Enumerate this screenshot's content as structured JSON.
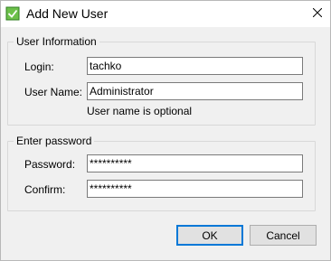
{
  "window": {
    "title": "Add New User",
    "icon": "app-icon",
    "close_icon": "close-icon"
  },
  "user_info": {
    "legend": "User Information",
    "login_label": "Login:",
    "login_value": "tachko",
    "username_label": "User Name:",
    "username_value": "Administrator",
    "hint": "User name is optional"
  },
  "password": {
    "legend": "Enter password",
    "password_label": "Password:",
    "password_value": "**********",
    "confirm_label": "Confirm:",
    "confirm_value": "**********"
  },
  "buttons": {
    "ok": "OK",
    "cancel": "Cancel"
  },
  "colors": {
    "accent": "#0078d7",
    "icon_green": "#3a9a3a"
  }
}
